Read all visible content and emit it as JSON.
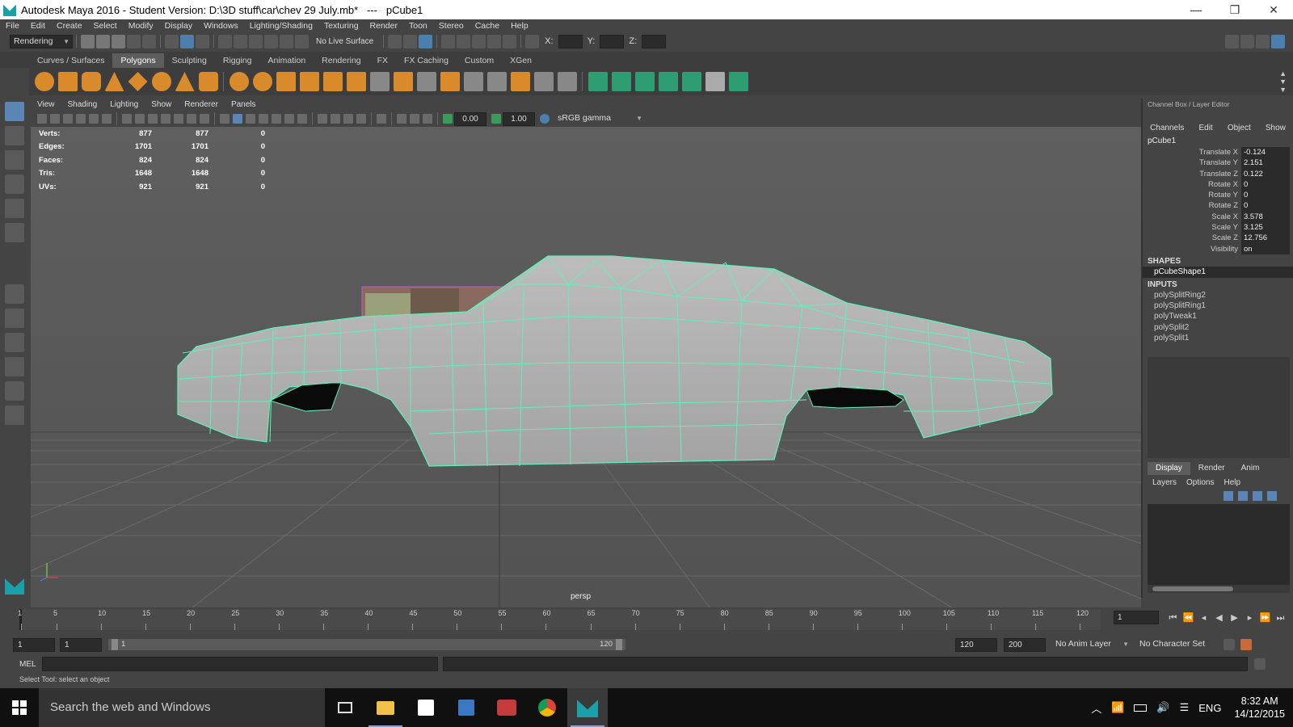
{
  "window": {
    "title": "Autodesk Maya 2016 - Student Version: D:\\3D stuff\\car\\chev 29 July.mb*   ---   pCube1",
    "minimize": "—",
    "restore": "❐",
    "close": "✕"
  },
  "menubar": [
    "File",
    "Edit",
    "Create",
    "Select",
    "Modify",
    "Display",
    "Windows",
    "Lighting/Shading",
    "Texturing",
    "Render",
    "Toon",
    "Stereo",
    "Cache",
    "Help"
  ],
  "statusline": {
    "menuset": "Rendering",
    "live_surface": "No Live Surface",
    "x_label": "X:",
    "y_label": "Y:",
    "z_label": "Z:"
  },
  "shelf_tabs": [
    "Curves / Surfaces",
    "Polygons",
    "Sculpting",
    "Rigging",
    "Animation",
    "Rendering",
    "FX",
    "FX Caching",
    "Custom",
    "XGen"
  ],
  "shelf_active": "Polygons",
  "viewport": {
    "menu": [
      "View",
      "Shading",
      "Lighting",
      "Show",
      "Renderer",
      "Panels"
    ],
    "exposure": "0.00",
    "gamma": "1.00",
    "colorspace": "sRGB gamma",
    "camera": "persp",
    "hud": [
      {
        "label": "Verts:",
        "a": "877",
        "b": "877",
        "c": "0"
      },
      {
        "label": "Edges:",
        "a": "1701",
        "b": "1701",
        "c": "0"
      },
      {
        "label": "Faces:",
        "a": "824",
        "b": "824",
        "c": "0"
      },
      {
        "label": "Tris:",
        "a": "1648",
        "b": "1648",
        "c": "0"
      },
      {
        "label": "UVs:",
        "a": "921",
        "b": "921",
        "c": "0"
      }
    ]
  },
  "channel_box": {
    "header": "Channel Box / Layer Editor",
    "menu": [
      "Channels",
      "Edit",
      "Object",
      "Show"
    ],
    "object": "pCube1",
    "attributes": [
      {
        "name": "Translate X",
        "value": "-0.124"
      },
      {
        "name": "Translate Y",
        "value": "2.151"
      },
      {
        "name": "Translate Z",
        "value": "0.122"
      },
      {
        "name": "Rotate X",
        "value": "0"
      },
      {
        "name": "Rotate Y",
        "value": "0"
      },
      {
        "name": "Rotate Z",
        "value": "0"
      },
      {
        "name": "Scale X",
        "value": "3.578"
      },
      {
        "name": "Scale Y",
        "value": "3.125"
      },
      {
        "name": "Scale Z",
        "value": "12.756"
      },
      {
        "name": "Visibility",
        "value": "on"
      }
    ],
    "shapes_label": "SHAPES",
    "shapes": [
      "pCubeShape1"
    ],
    "inputs_label": "INPUTS",
    "inputs": [
      "polySplitRing2",
      "polySplitRing1",
      "polyTweak1",
      "polySplit2",
      "polySplit1"
    ],
    "layer_tabs": [
      "Display",
      "Render",
      "Anim"
    ],
    "layer_menu": [
      "Layers",
      "Options",
      "Help"
    ]
  },
  "timeline": {
    "ticks": [
      "1",
      "5",
      "10",
      "15",
      "20",
      "25",
      "30",
      "35",
      "40",
      "45",
      "50",
      "55",
      "60",
      "65",
      "70",
      "75",
      "80",
      "85",
      "90",
      "95",
      "100",
      "105",
      "110",
      "115",
      "120"
    ],
    "current_frame": "1"
  },
  "range": {
    "start": "1",
    "playback_start": "1",
    "slider_start": "1",
    "slider_end": "120",
    "playback_end": "120",
    "end": "200",
    "anim_layer": "No Anim Layer",
    "char_set": "No Character Set"
  },
  "command": {
    "lang": "MEL"
  },
  "helpline": "Select Tool: select an object",
  "taskbar": {
    "search": "Search the web and Windows",
    "lang": "ENG",
    "time": "8:32 AM",
    "date": "14/12/2015"
  },
  "colors": {
    "wire": "#5ef2b8",
    "accent": "#5b85b5",
    "maya_teal": "#1aa0a8"
  }
}
